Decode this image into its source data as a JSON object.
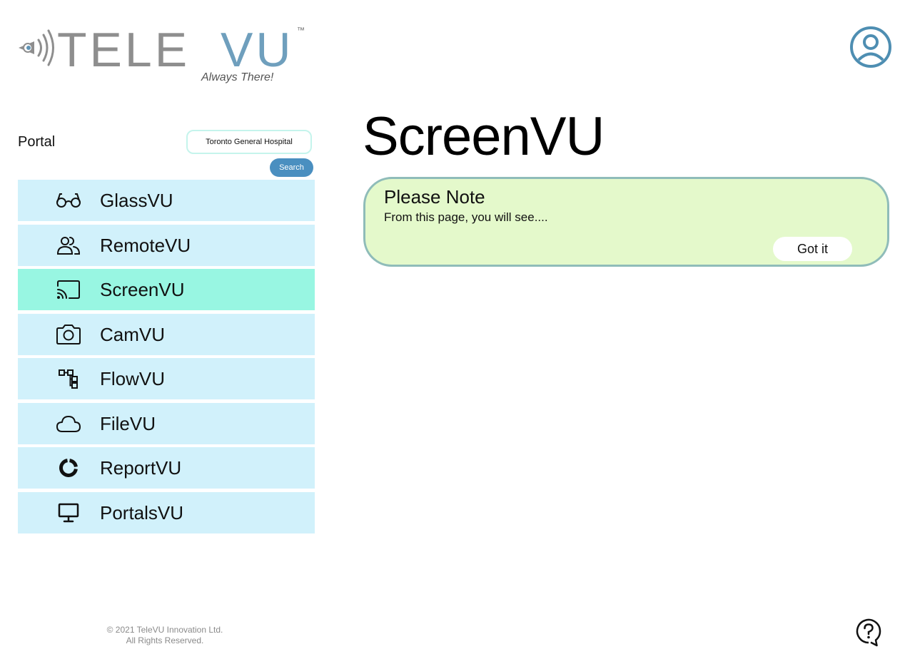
{
  "header": {
    "logo": {
      "brand_left": "TELE",
      "brand_right": "VU",
      "trademark": "™",
      "tagline": "Always There!"
    },
    "avatar_icon": "user-circle-icon"
  },
  "sidebar": {
    "portal_label": "Portal",
    "portal_value": "Toronto General Hospital",
    "search_label": "Search",
    "items": [
      {
        "label": "GlassVU",
        "icon": "glasses-icon",
        "active": false
      },
      {
        "label": "RemoteVU",
        "icon": "users-icon",
        "active": false
      },
      {
        "label": "ScreenVU",
        "icon": "cast-icon",
        "active": true
      },
      {
        "label": "CamVU",
        "icon": "camera-icon",
        "active": false
      },
      {
        "label": "FlowVU",
        "icon": "flowchart-icon",
        "active": false
      },
      {
        "label": "FileVU",
        "icon": "cloud-icon",
        "active": false
      },
      {
        "label": "ReportVU",
        "icon": "donut-chart-icon",
        "active": false
      },
      {
        "label": "PortalsVU",
        "icon": "monitor-icon",
        "active": false
      }
    ]
  },
  "main": {
    "title": "ScreenVU",
    "note": {
      "title": "Please Note",
      "text": "From this page, you will see....",
      "button": "Got it"
    }
  },
  "footer": {
    "copyright": "© 2021 TeleVU Innovation Ltd.",
    "rights": "All Rights Reserved."
  },
  "help_icon": "help-bubble-icon",
  "colors": {
    "nav_bg": "#d1f1fb",
    "nav_active_bg": "#98f6e2",
    "note_bg": "#e4f9cb",
    "note_border": "#8fbcb9",
    "accent_blue": "#4a8fc0",
    "logo_gray": "#8e8e8e",
    "logo_blue": "#6f9fbd"
  }
}
